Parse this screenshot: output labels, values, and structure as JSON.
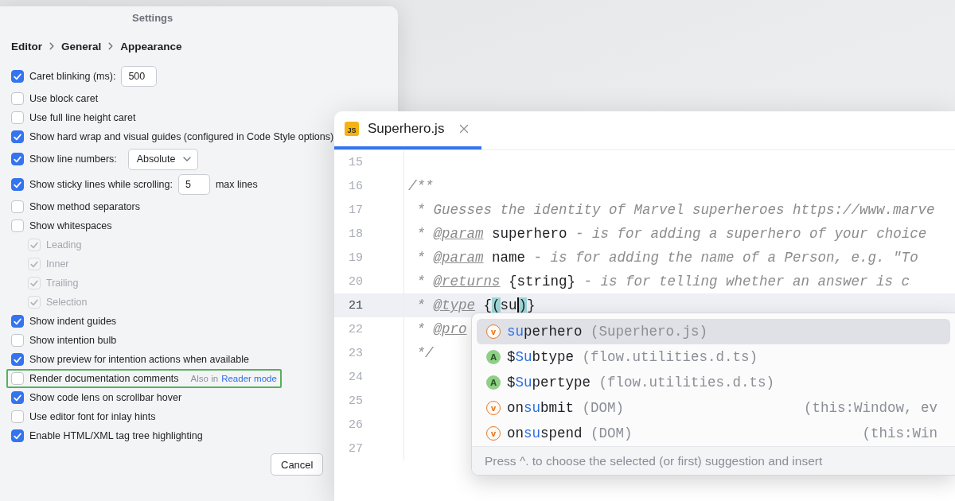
{
  "settings": {
    "title": "Settings",
    "breadcrumb": [
      "Editor",
      "General",
      "Appearance"
    ],
    "options": [
      {
        "kind": "number",
        "label": "Caret blinking (ms):",
        "checked": true,
        "highlighted": false,
        "value": "500"
      },
      {
        "kind": "checkbox",
        "label": "Use block caret",
        "checked": false,
        "highlighted": false
      },
      {
        "kind": "checkbox",
        "label": "Use full line height caret",
        "checked": false,
        "highlighted": false
      },
      {
        "kind": "checkbox",
        "label": "Show hard wrap and visual guides (configured in Code Style options)",
        "checked": true,
        "highlighted": false
      },
      {
        "kind": "dropdown",
        "label": "Show line numbers:",
        "checked": true,
        "highlighted": false,
        "value": "Absolute"
      },
      {
        "kind": "number",
        "label": "Show sticky lines while scrolling:",
        "checked": true,
        "highlighted": false,
        "value": "5",
        "suffix": "max lines"
      },
      {
        "kind": "checkbox",
        "label": "Show method separators",
        "checked": false,
        "highlighted": false
      },
      {
        "kind": "checkbox",
        "label": "Show whitespaces",
        "checked": false,
        "highlighted": false,
        "children": [
          {
            "kind": "checkbox",
            "label": "Leading",
            "checked": true,
            "disabled": true
          },
          {
            "kind": "checkbox",
            "label": "Inner",
            "checked": true,
            "disabled": true
          },
          {
            "kind": "checkbox",
            "label": "Trailing",
            "checked": true,
            "disabled": true
          },
          {
            "kind": "checkbox",
            "label": "Selection",
            "checked": true,
            "disabled": true
          }
        ]
      },
      {
        "kind": "checkbox",
        "label": "Show indent guides",
        "checked": true,
        "highlighted": false
      },
      {
        "kind": "checkbox",
        "label": "Show intention bulb",
        "checked": false,
        "highlighted": false
      },
      {
        "kind": "checkbox",
        "label": "Show preview for intention actions when available",
        "checked": true,
        "highlighted": false
      },
      {
        "kind": "checkbox",
        "label": "Render documentation comments",
        "checked": false,
        "highlighted": true,
        "hint": "Also in",
        "link": "Reader mode"
      },
      {
        "kind": "checkbox",
        "label": "Show code lens on scrollbar hover",
        "checked": true,
        "highlighted": false
      },
      {
        "kind": "checkbox",
        "label": "Use editor font for inlay hints",
        "checked": false,
        "highlighted": false
      },
      {
        "kind": "checkbox",
        "label": "Enable HTML/XML tag tree highlighting",
        "checked": true,
        "highlighted": false
      }
    ],
    "buttons": [
      "Cancel"
    ]
  },
  "editor": {
    "tabs": [
      {
        "label": "Superhero.js",
        "icon_text": "JS",
        "selected": true
      }
    ],
    "lines": [
      {
        "number": "15",
        "current": false
      },
      {
        "number": "16",
        "current": false,
        "tokens": [
          {
            "text": "/**",
            "kind": "comment"
          }
        ]
      },
      {
        "number": "17",
        "current": false,
        "tokens": [
          {
            "text": " * Guesses the identity of Marvel superheroes https://www.marve",
            "kind": "comment"
          }
        ]
      },
      {
        "number": "18",
        "current": false,
        "tokens": [
          {
            "text": " * ",
            "kind": "comment"
          },
          {
            "text": "@param",
            "kind": "tag"
          },
          {
            "text": " superhero",
            "kind": "code"
          },
          {
            "text": " - is for adding a superhero of your choice",
            "kind": "comment"
          }
        ]
      },
      {
        "number": "19",
        "current": false,
        "tokens": [
          {
            "text": " * ",
            "kind": "comment"
          },
          {
            "text": "@param",
            "kind": "tag"
          },
          {
            "text": " name",
            "kind": "code"
          },
          {
            "text": " - is for adding the name of a Person, e.g. \"To",
            "kind": "comment"
          }
        ]
      },
      {
        "number": "20",
        "current": false,
        "tokens": [
          {
            "text": " * ",
            "kind": "comment"
          },
          {
            "text": "@returns",
            "kind": "tag"
          },
          {
            "text": " {string}",
            "kind": "code"
          },
          {
            "text": " - is for telling whether an answer is c",
            "kind": "comment"
          }
        ]
      },
      {
        "number": "21",
        "current": true,
        "tokens": [
          {
            "text": " * ",
            "kind": "comment",
            "caret_after": false
          },
          {
            "text": "@type",
            "kind": "tag",
            "caret_after": false
          },
          {
            "text": " {",
            "kind": "code",
            "caret_after": false
          },
          {
            "text": "(",
            "kind": "brace_match",
            "caret_after": false
          },
          {
            "text": "su",
            "kind": "code",
            "caret_after": true
          },
          {
            "text": ")",
            "kind": "brace_match",
            "caret_after": false
          },
          {
            "text": "}",
            "kind": "code",
            "caret_after": false
          }
        ]
      },
      {
        "number": "22",
        "current": false,
        "tokens": [
          {
            "text": " * ",
            "kind": "comment"
          },
          {
            "text": "@pro",
            "kind": "tag"
          }
        ]
      },
      {
        "number": "23",
        "current": false,
        "tokens": [
          {
            "text": " */",
            "kind": "comment"
          }
        ]
      },
      {
        "number": "24",
        "current": false
      },
      {
        "number": "25",
        "current": false
      },
      {
        "number": "26",
        "current": false
      },
      {
        "number": "27",
        "current": false
      }
    ],
    "completion": {
      "items": [
        {
          "kind": "variable",
          "icon_letter": "v",
          "match": "su",
          "rest": "perhero",
          "location": "(Superhero.js)",
          "selected": true
        },
        {
          "kind": "alias",
          "icon_letter": "A",
          "prefix": "$",
          "match": "Su",
          "rest": "btype",
          "location": "(flow.utilities.d.ts)",
          "selected": false
        },
        {
          "kind": "alias",
          "icon_letter": "A",
          "prefix": "$",
          "match": "Su",
          "rest": "pertype",
          "location": "(flow.utilities.d.ts)",
          "selected": false
        },
        {
          "kind": "variable",
          "icon_letter": "v",
          "prefix": "on",
          "match": "su",
          "rest": "bmit",
          "location": "(DOM)",
          "signature": "(this:Window, ev",
          "selected": false
        },
        {
          "kind": "variable",
          "icon_letter": "v",
          "prefix": "on",
          "match": "su",
          "rest": "spend",
          "location": "(DOM)",
          "signature": "(this:Win",
          "selected": false
        }
      ],
      "footer": "Press ^. to choose the selected (or first) suggestion and insert"
    }
  }
}
